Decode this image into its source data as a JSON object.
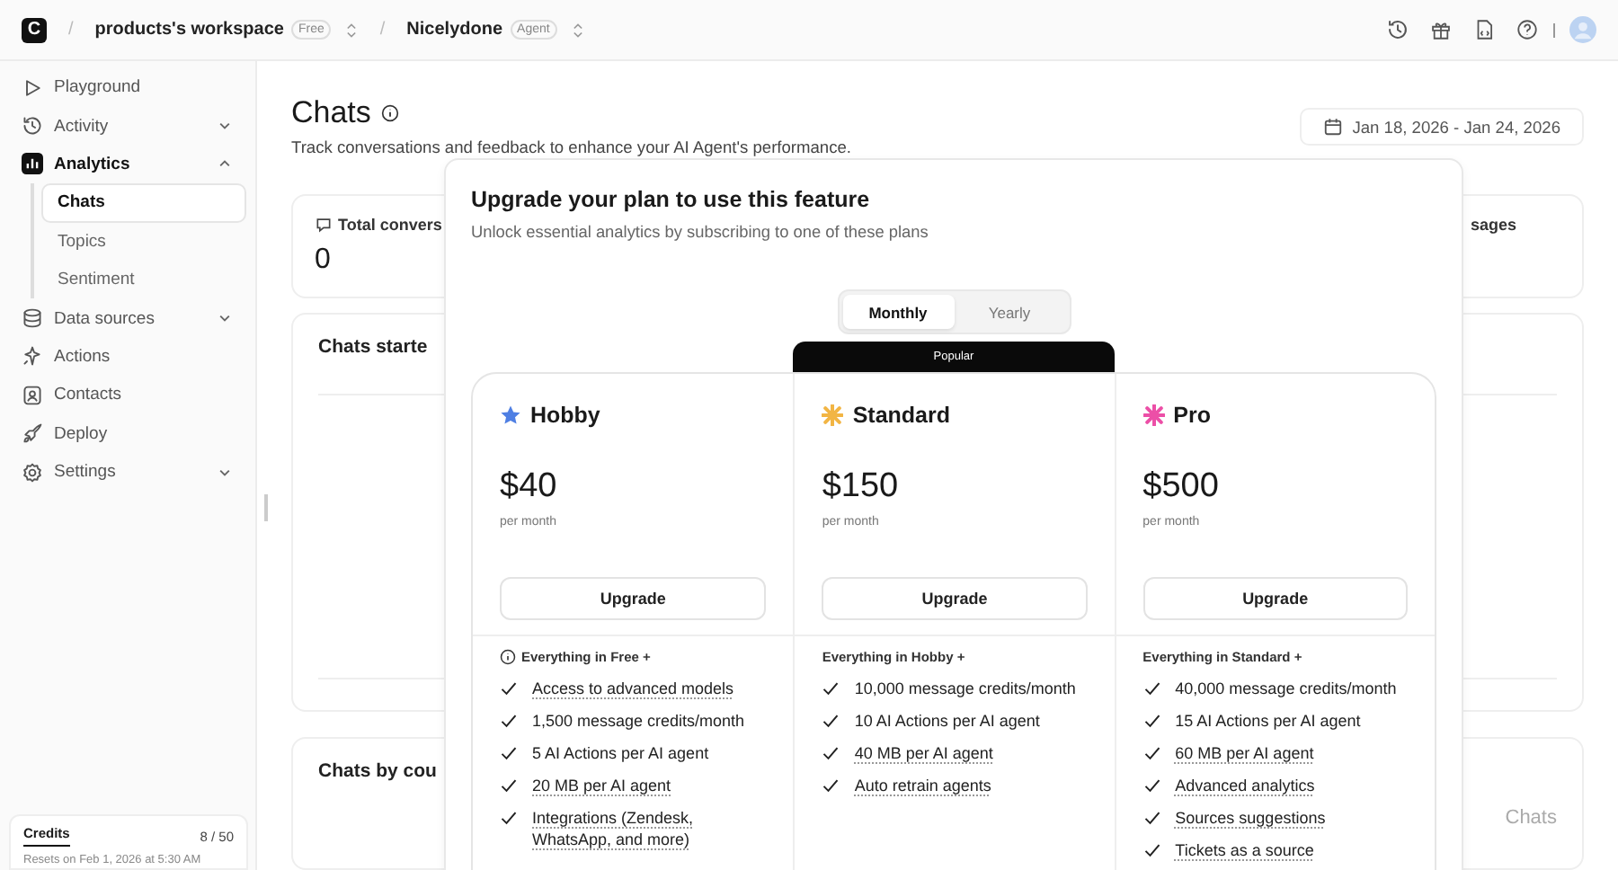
{
  "topbar": {
    "logo": "C",
    "crumbs": [
      {
        "separator": "/",
        "label": "products's workspace",
        "badge": "Free"
      },
      {
        "separator": "/",
        "label": "Nicelydone",
        "badge": "Agent"
      }
    ]
  },
  "sidebar": {
    "items": [
      {
        "kind": "link",
        "label": "Playground",
        "selected": false
      },
      {
        "kind": "group",
        "label": "Activity",
        "selected": false,
        "expanded": false
      },
      {
        "kind": "group",
        "label": "Analytics",
        "selected": true,
        "expanded": true,
        "children": [
          {
            "label": "Chats",
            "selected": true
          },
          {
            "label": "Topics",
            "selected": false
          },
          {
            "label": "Sentiment",
            "selected": false
          }
        ]
      },
      {
        "kind": "group",
        "label": "Data sources",
        "selected": false,
        "expanded": false
      },
      {
        "kind": "link",
        "label": "Actions",
        "selected": false
      },
      {
        "kind": "link",
        "label": "Contacts",
        "selected": false
      },
      {
        "kind": "link",
        "label": "Deploy",
        "selected": false
      },
      {
        "kind": "group",
        "label": "Settings",
        "selected": false,
        "expanded": false
      }
    ],
    "credits": {
      "label": "Credits",
      "value": "8 / 50",
      "note": "Resets on Feb 1, 2026 at 5:30 AM"
    }
  },
  "page": {
    "title": "Chats",
    "subtitle": "Track conversations and feedback to enhance your AI Agent's performance.",
    "date_range": "Jan 18, 2026 - Jan 24, 2026"
  },
  "stat_cards": [
    {
      "label": "Total convers",
      "value": "0"
    },
    {
      "label": "sages"
    }
  ],
  "chart_cards": [
    {
      "title": "Chats starte"
    },
    {
      "title": "Chats by cou",
      "axis_label": "Chats"
    }
  ],
  "modal": {
    "title": "Upgrade your plan to use this feature",
    "subtitle": "Unlock essential analytics by subscribing to one of these plans",
    "billing": [
      {
        "label": "Monthly",
        "selected": true
      },
      {
        "label": "Yearly",
        "selected": false
      }
    ],
    "plans": [
      {
        "name": "Hobby",
        "color": "#4f7fe3",
        "price": "$40",
        "period": "per month",
        "button": "Upgrade",
        "features_title": "Everything in Free +",
        "info": true,
        "features": [
          {
            "text": "Access to advanced models",
            "underlined": true
          },
          {
            "text": "1,500 message credits/month",
            "underlined": false
          },
          {
            "text": "5 AI Actions per AI agent",
            "underlined": false
          },
          {
            "text": "20 MB per AI agent",
            "underlined": true
          },
          {
            "text": "Integrations (Zendesk, WhatsApp, and more)",
            "underlined": true
          }
        ]
      },
      {
        "name": "Standard",
        "color": "#f2b544",
        "badge": "Popular",
        "price": "$150",
        "period": "per month",
        "button": "Upgrade",
        "features_title": "Everything in Hobby +",
        "info": false,
        "features": [
          {
            "text": "10,000 message credits/month",
            "underlined": false
          },
          {
            "text": "10 AI Actions per AI agent",
            "underlined": false
          },
          {
            "text": "40 MB per AI agent",
            "underlined": true
          },
          {
            "text": "Auto retrain agents",
            "underlined": true
          }
        ]
      },
      {
        "name": "Pro",
        "color": "#ec4fa7",
        "price": "$500",
        "period": "per month",
        "button": "Upgrade",
        "features_title": "Everything in Standard +",
        "info": false,
        "features": [
          {
            "text": "40,000 message credits/month",
            "underlined": false
          },
          {
            "text": "15 AI Actions per AI agent",
            "underlined": false
          },
          {
            "text": "60 MB per AI agent",
            "underlined": true
          },
          {
            "text": "Advanced analytics",
            "underlined": true
          },
          {
            "text": "Sources suggestions",
            "underlined": true
          },
          {
            "text": "Tickets as a source",
            "underlined": true
          }
        ]
      }
    ]
  }
}
